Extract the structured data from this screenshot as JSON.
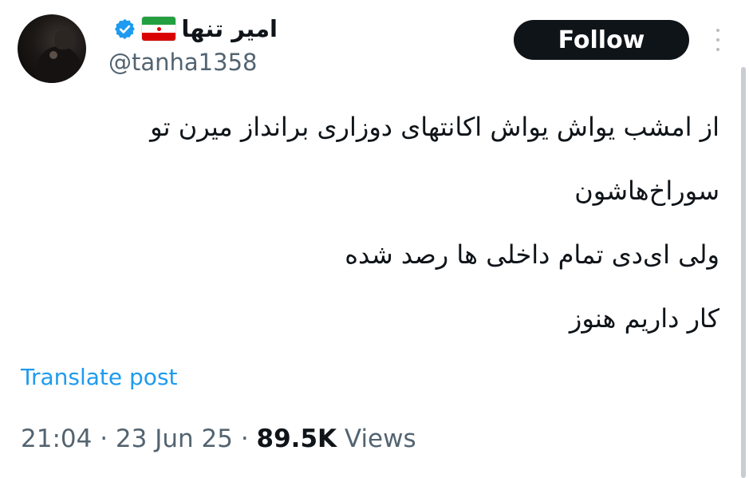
{
  "author": {
    "display_name": "امیر تنها",
    "handle": "@tanha1358",
    "verified": true,
    "flag": "iran-flag-icon"
  },
  "actions": {
    "follow_label": "Follow",
    "more_icon": "more-vertical-icon"
  },
  "tweet": {
    "lines": [
      "از امشب یواش یواش اکانتهای دوزاری برانداز میرن تو",
      "سوراخ‌هاشون",
      "ولی ای‌دی تمام داخلی ها رصد شده",
      "کار داریم هنوز"
    ],
    "translate_label": "Translate post"
  },
  "meta": {
    "time": "21:04",
    "sep1": "·",
    "date": "23 Jun 25",
    "sep2": "·",
    "views_count": "89.5K",
    "views_label": "Views"
  },
  "colors": {
    "text": "#0f1419",
    "secondary": "#536471",
    "link": "#1d9bf0",
    "verified": "#1d9bf0",
    "follow_bg": "#0f1419"
  }
}
